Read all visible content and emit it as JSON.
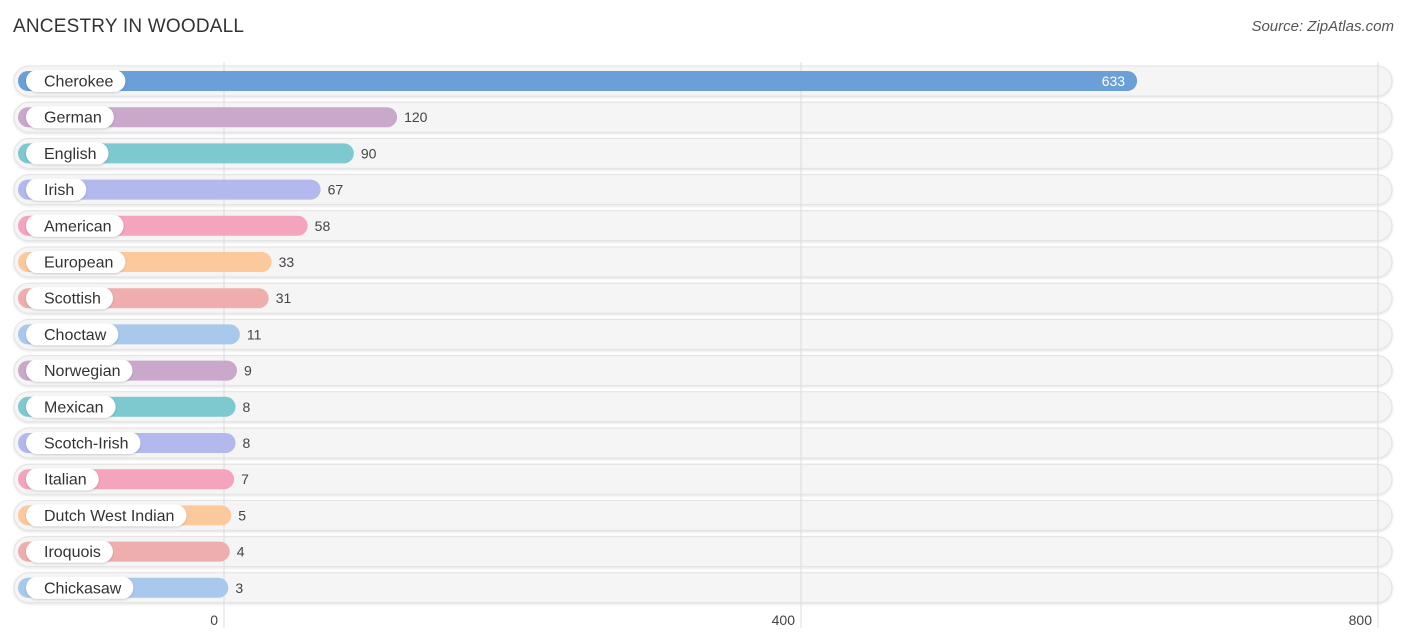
{
  "header": {
    "title": "ANCESTRY IN WOODALL",
    "source": "Source: ZipAtlas.com"
  },
  "chart_data": {
    "type": "bar",
    "orientation": "horizontal",
    "title": "ANCESTRY IN WOODALL",
    "xlabel": "",
    "ylabel": "",
    "xlim": [
      0,
      800
    ],
    "x_ticks": [
      0,
      400,
      800
    ],
    "x_tick_labels": [
      "0",
      "400",
      "800"
    ],
    "grid": true,
    "legend": "none",
    "categories": [
      "Cherokee",
      "German",
      "English",
      "Irish",
      "American",
      "European",
      "Scottish",
      "Choctaw",
      "Norwegian",
      "Mexican",
      "Scotch-Irish",
      "Italian",
      "Dutch West Indian",
      "Iroquois",
      "Chickasaw"
    ],
    "values": [
      633,
      120,
      90,
      67,
      58,
      33,
      31,
      11,
      9,
      8,
      8,
      7,
      5,
      4,
      3
    ],
    "value_labels": [
      "633",
      "120",
      "90",
      "67",
      "58",
      "33",
      "31",
      "11",
      "9",
      "8",
      "8",
      "7",
      "5",
      "4",
      "3"
    ],
    "colors": [
      "#6a9fd8",
      "#c9a8cc",
      "#7ec8cf",
      "#b3b9ec",
      "#f4a4bc",
      "#fbc99c",
      "#efaeae",
      "#a8c8ec",
      "#c9a8cc",
      "#7ec8cf",
      "#b3b9ec",
      "#f4a4bc",
      "#fbc99c",
      "#efaeae",
      "#a8c8ec"
    ]
  }
}
